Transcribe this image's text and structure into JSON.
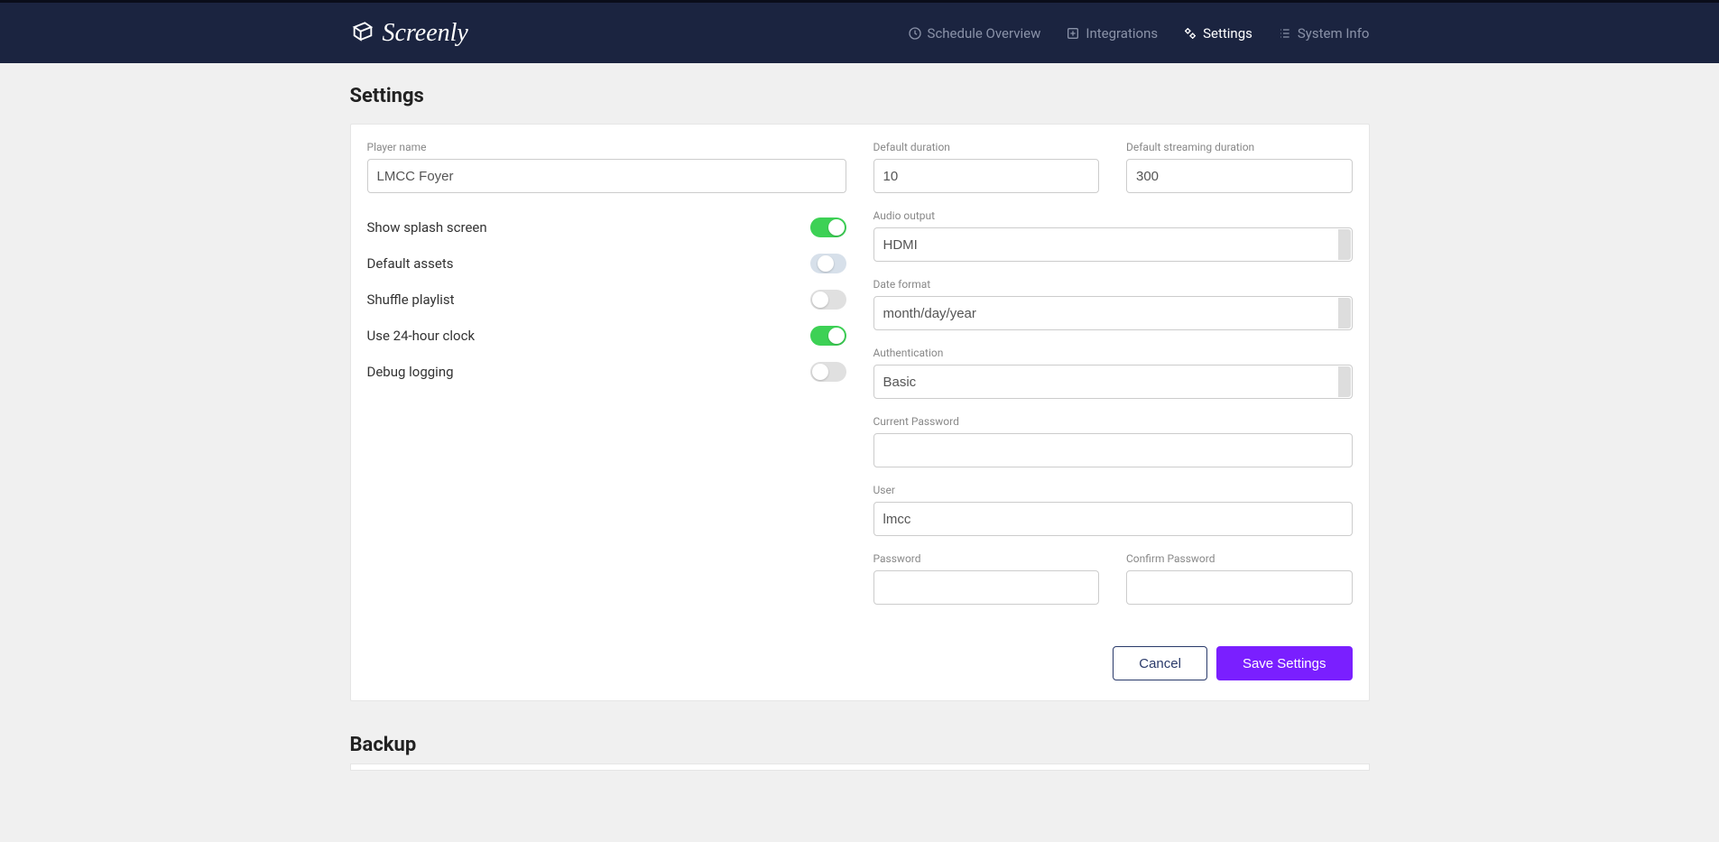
{
  "brand": "Screenly",
  "nav": {
    "schedule": "Schedule Overview",
    "integrations": "Integrations",
    "settings": "Settings",
    "systeminfo": "System Info"
  },
  "page": {
    "title": "Settings",
    "backupTitle": "Backup"
  },
  "labels": {
    "playerName": "Player name",
    "defaultDuration": "Default duration",
    "defaultStreamingDuration": "Default streaming duration",
    "audioOutput": "Audio output",
    "dateFormat": "Date format",
    "authentication": "Authentication",
    "currentPassword": "Current Password",
    "user": "User",
    "password": "Password",
    "confirmPassword": "Confirm Password",
    "showSplash": "Show splash screen",
    "defaultAssets": "Default assets",
    "shufflePlaylist": "Shuffle playlist",
    "use24h": "Use 24-hour clock",
    "debugLogging": "Debug logging"
  },
  "values": {
    "playerName": "LMCC Foyer",
    "defaultDuration": "10",
    "defaultStreamingDuration": "300",
    "audioOutput": "HDMI",
    "dateFormat": "month/day/year",
    "authentication": "Basic",
    "currentPassword": "",
    "user": "lmcc",
    "password": "",
    "confirmPassword": ""
  },
  "toggles": {
    "showSplash": true,
    "defaultAssets": "partial",
    "shufflePlaylist": false,
    "use24h": true,
    "debugLogging": false
  },
  "buttons": {
    "cancel": "Cancel",
    "save": "Save Settings"
  }
}
